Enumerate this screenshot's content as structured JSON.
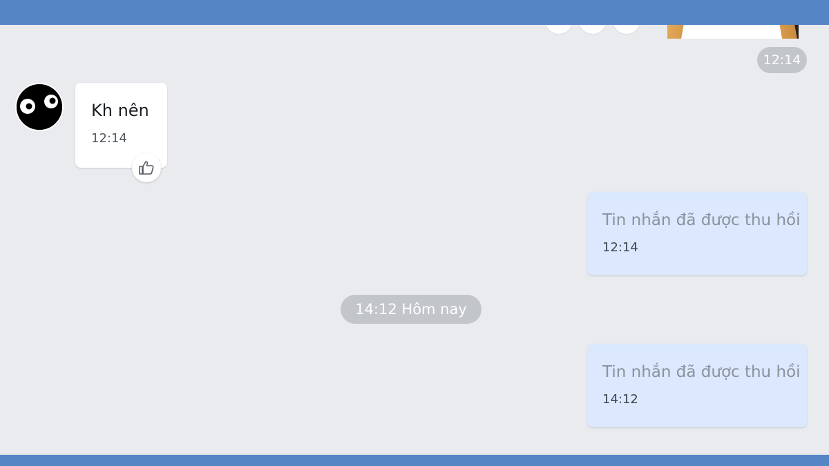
{
  "colors": {
    "header": "#5585c5",
    "background": "#e9ebee",
    "incoming_bubble": "#ffffff",
    "outgoing_bubble": "#dbe8fd",
    "pill": "#c2c5ca"
  },
  "previous_message": {
    "time": "12:14",
    "content": "sticker"
  },
  "incoming_message": {
    "avatar_icon": "cartoon-eyes-avatar-icon",
    "text": "Kh nên",
    "time": "12:14",
    "reaction_icon": "thumbs-up-icon"
  },
  "outgoing_messages": [
    {
      "text": "Tin nhắn đã được thu hồi",
      "time": "12:14"
    },
    {
      "text": "Tin nhắn đã được thu hồi",
      "time": "14:12"
    }
  ],
  "date_divider": "14:12 Hôm nay"
}
